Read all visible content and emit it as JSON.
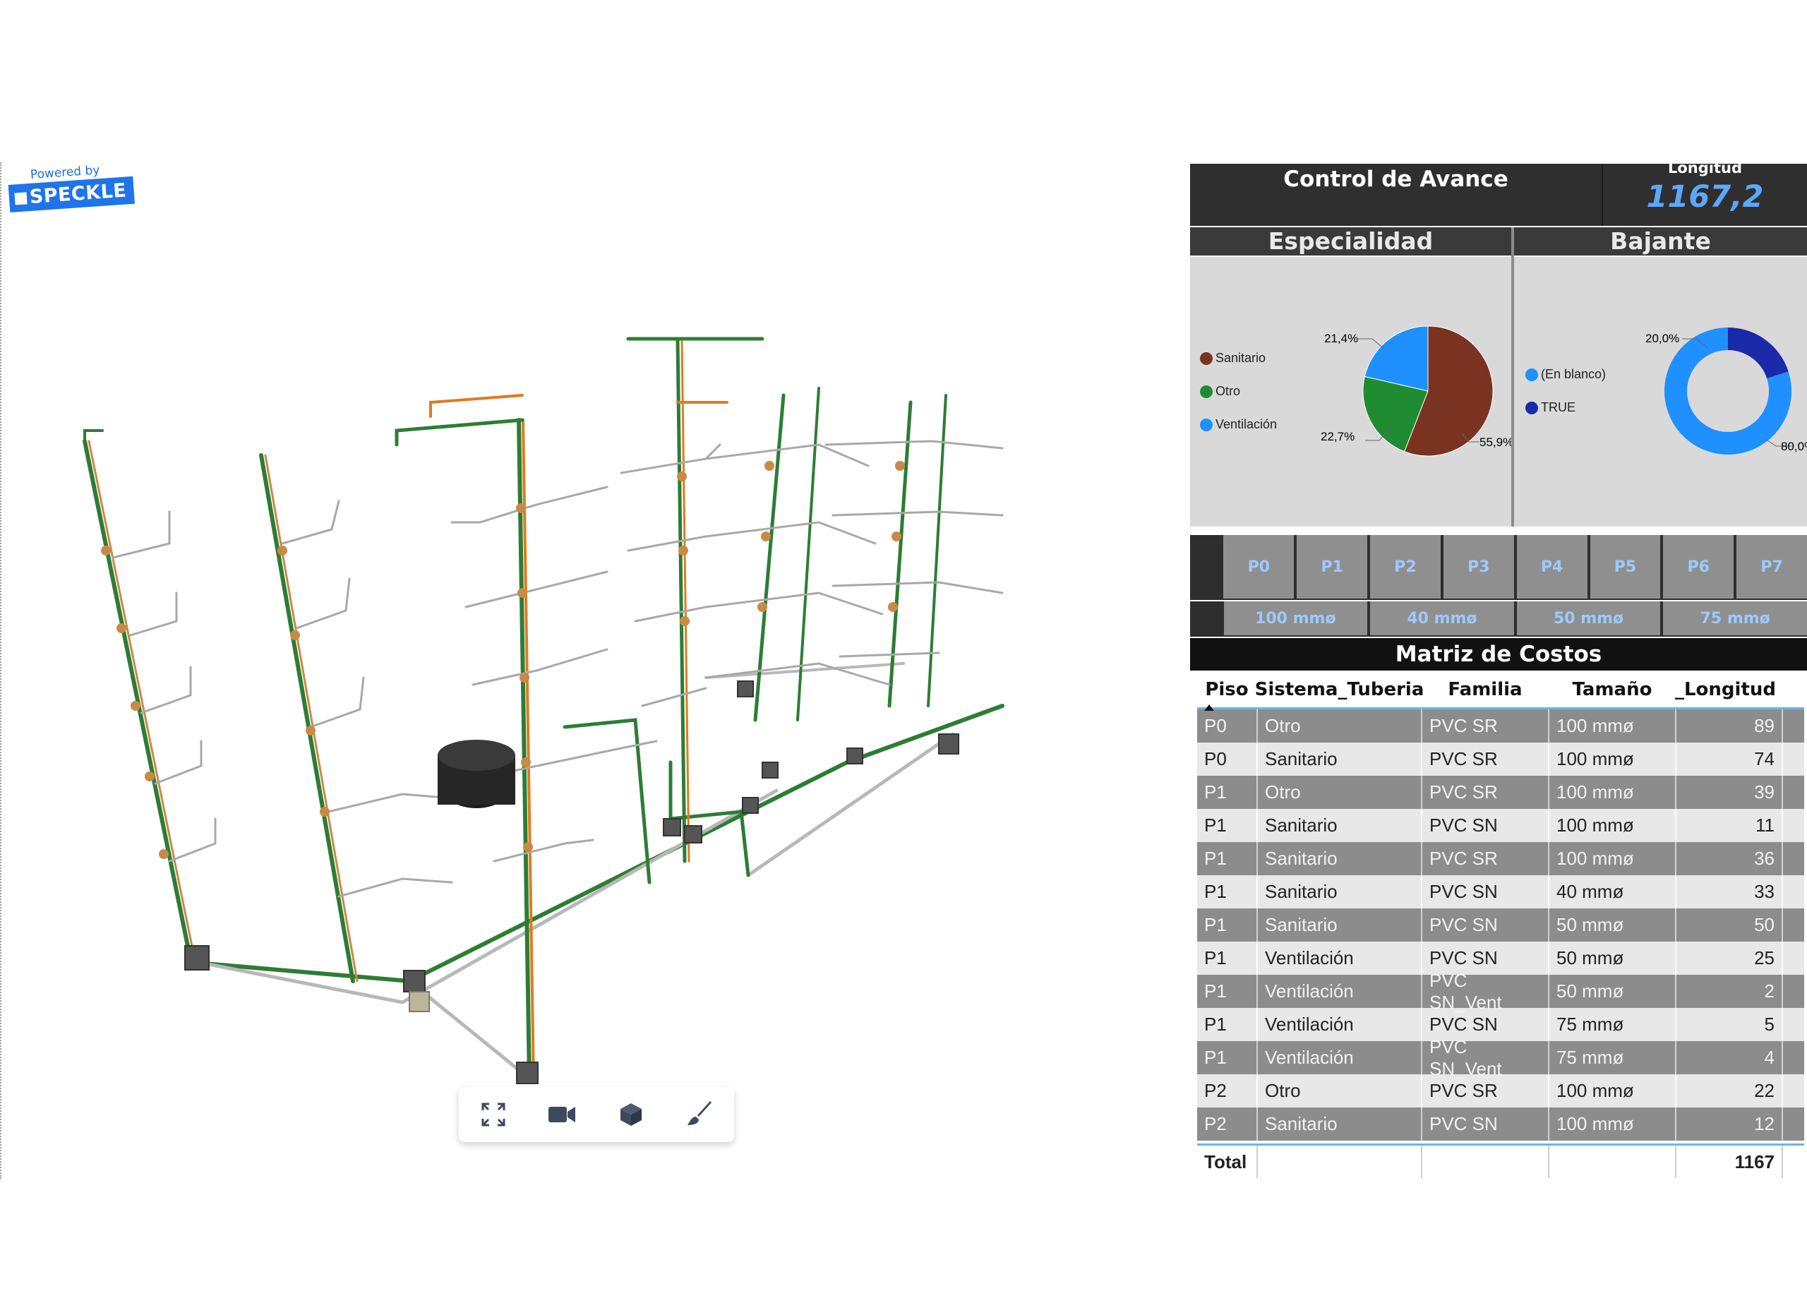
{
  "viewer": {
    "powered_by": "Powered by",
    "brand": "SPECKLE",
    "toolbar": [
      "fullscreen-icon",
      "camera-icon",
      "cube-icon",
      "brush-icon"
    ]
  },
  "dashboard": {
    "title": "Control de Avance",
    "longitud_label": "Longitud",
    "longitud_value": "1167,2",
    "especialidad": {
      "title": "Especialidad",
      "legend": [
        {
          "label": "Sanitario",
          "color": "#7a3320"
        },
        {
          "label": "Otro",
          "color": "#1f8c32"
        },
        {
          "label": "Ventilación",
          "color": "#1e90ff"
        }
      ],
      "labels": {
        "sanitario": "55,9%",
        "otro": "22,7%",
        "ventilacion": "21,4%"
      }
    },
    "bajante": {
      "title": "Bajante",
      "legend": [
        {
          "label": "(En blanco)",
          "color": "#1e90ff"
        },
        {
          "label": "TRUE",
          "color": "#1a2aa8"
        }
      ],
      "labels": {
        "true": "20,0%",
        "blank": "80,0%"
      }
    },
    "floors": [
      "P0",
      "P1",
      "P2",
      "P3",
      "P4",
      "P5",
      "P6",
      "P7"
    ],
    "sizes": [
      "100 mmø",
      "40 mmø",
      "50 mmø",
      "75 mmø"
    ],
    "matrix": {
      "title": "Matriz de Costos",
      "columns": [
        "Piso",
        "Sistema_Tuberia",
        "Familia",
        "Tamaño",
        "_Longitud"
      ],
      "rows": [
        [
          "P0",
          "Otro",
          "PVC SR",
          "100 mmø",
          "89"
        ],
        [
          "P0",
          "Sanitario",
          "PVC SR",
          "100 mmø",
          "74"
        ],
        [
          "P1",
          "Otro",
          "PVC SR",
          "100 mmø",
          "39"
        ],
        [
          "P1",
          "Sanitario",
          "PVC SN",
          "100 mmø",
          "11"
        ],
        [
          "P1",
          "Sanitario",
          "PVC SR",
          "100 mmø",
          "36"
        ],
        [
          "P1",
          "Sanitario",
          "PVC SN",
          "40 mmø",
          "33"
        ],
        [
          "P1",
          "Sanitario",
          "PVC SN",
          "50 mmø",
          "50"
        ],
        [
          "P1",
          "Ventilación",
          "PVC SN",
          "50 mmø",
          "25"
        ],
        [
          "P1",
          "Ventilación",
          "PVC SN_Vent",
          "50 mmø",
          "2"
        ],
        [
          "P1",
          "Ventilación",
          "PVC SN",
          "75 mmø",
          "5"
        ],
        [
          "P1",
          "Ventilación",
          "PVC SN_Vent",
          "75 mmø",
          "4"
        ],
        [
          "P2",
          "Otro",
          "PVC SR",
          "100 mmø",
          "22"
        ],
        [
          "P2",
          "Sanitario",
          "PVC SN",
          "100 mmø",
          "12"
        ]
      ],
      "total_label": "Total",
      "total_value": "1167"
    },
    "chart_data": [
      {
        "type": "pie",
        "title": "Especialidad",
        "categories": [
          "Sanitario",
          "Otro",
          "Ventilación"
        ],
        "values": [
          55.9,
          22.7,
          21.4
        ]
      },
      {
        "type": "pie",
        "title": "Bajante",
        "categories": [
          "(En blanco)",
          "TRUE"
        ],
        "values": [
          80.0,
          20.0
        ]
      }
    ]
  }
}
